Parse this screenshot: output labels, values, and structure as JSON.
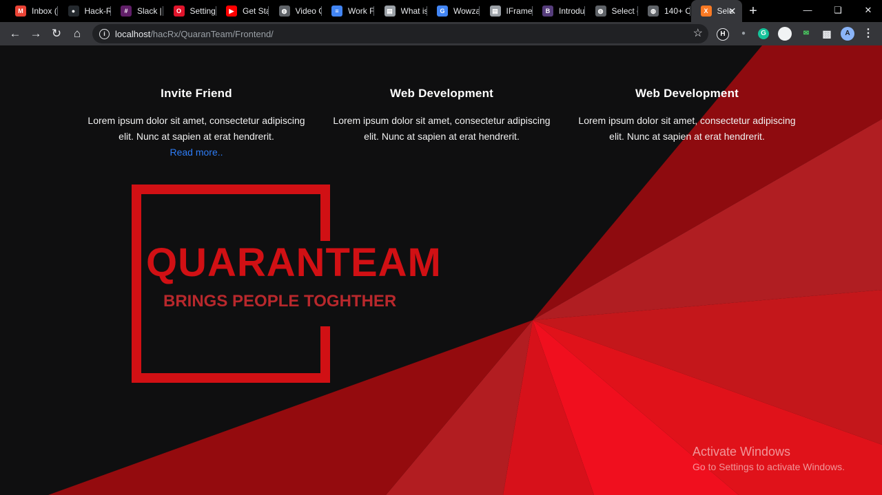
{
  "browser": {
    "tabs": [
      {
        "label": "Inbox (",
        "icon": "gmail-icon",
        "color": "#ea4335",
        "glyph": "M"
      },
      {
        "label": "Hack-R",
        "icon": "github-icon",
        "color": "#24292e",
        "glyph": "●"
      },
      {
        "label": "Slack |",
        "icon": "slack-icon",
        "color": "#611f69",
        "glyph": "#"
      },
      {
        "label": "Setting",
        "icon": "opera-icon",
        "color": "#e0142b",
        "glyph": "O"
      },
      {
        "label": "Get Sta",
        "icon": "youtube-icon",
        "color": "#ff0000",
        "glyph": "▶"
      },
      {
        "label": "Video C",
        "icon": "globe-icon",
        "color": "#5f6368",
        "glyph": "◍"
      },
      {
        "label": "Work F",
        "icon": "docs-icon",
        "color": "#4285f4",
        "glyph": "≡"
      },
      {
        "label": "What is",
        "icon": "page-icon",
        "color": "#9aa0a6",
        "glyph": "▤"
      },
      {
        "label": "Wowza",
        "icon": "google-icon",
        "color": "#4285f4",
        "glyph": "G"
      },
      {
        "label": "IFrame",
        "icon": "page-icon",
        "color": "#9aa0a6",
        "glyph": "▤"
      },
      {
        "label": "Introdu",
        "icon": "bootstrap-icon",
        "color": "#563d7c",
        "glyph": "B"
      },
      {
        "label": "Select c",
        "icon": "globe-icon",
        "color": "#5f6368",
        "glyph": "◍"
      },
      {
        "label": "140+ C",
        "icon": "globe-icon",
        "color": "#5f6368",
        "glyph": "◍"
      },
      {
        "label": "Sele",
        "icon": "xampp-icon",
        "color": "#fb7a24",
        "glyph": "X"
      }
    ],
    "new_tab": "+",
    "url_host": "localhost",
    "url_path": "/hacRx/QuaranTeam/Frontend/"
  },
  "page": {
    "cards": [
      {
        "title": "Invite Friend",
        "text": "Lorem ipsum dolor sit amet, consectetur adipiscing elit. Nunc at sapien at erat hendrerit.",
        "link": "Read more.."
      },
      {
        "title": "Web Development",
        "text": "Lorem ipsum dolor sit amet, consectetur adipiscing elit. Nunc at sapien at erat hendrerit."
      },
      {
        "title": "Web Development",
        "text": "Lorem ipsum dolor sit amet, consectetur adipiscing elit. Nunc at sapien at erat hendrerit."
      }
    ],
    "brand": "QUARANTEAM",
    "tagline": "BRINGS PEOPLE TOGHTHER",
    "accent": "#d11014",
    "link_color": "#2d7cf6"
  },
  "os": {
    "watermark_title": "Activate Windows",
    "watermark_subtitle": "Go to Settings to activate Windows."
  }
}
